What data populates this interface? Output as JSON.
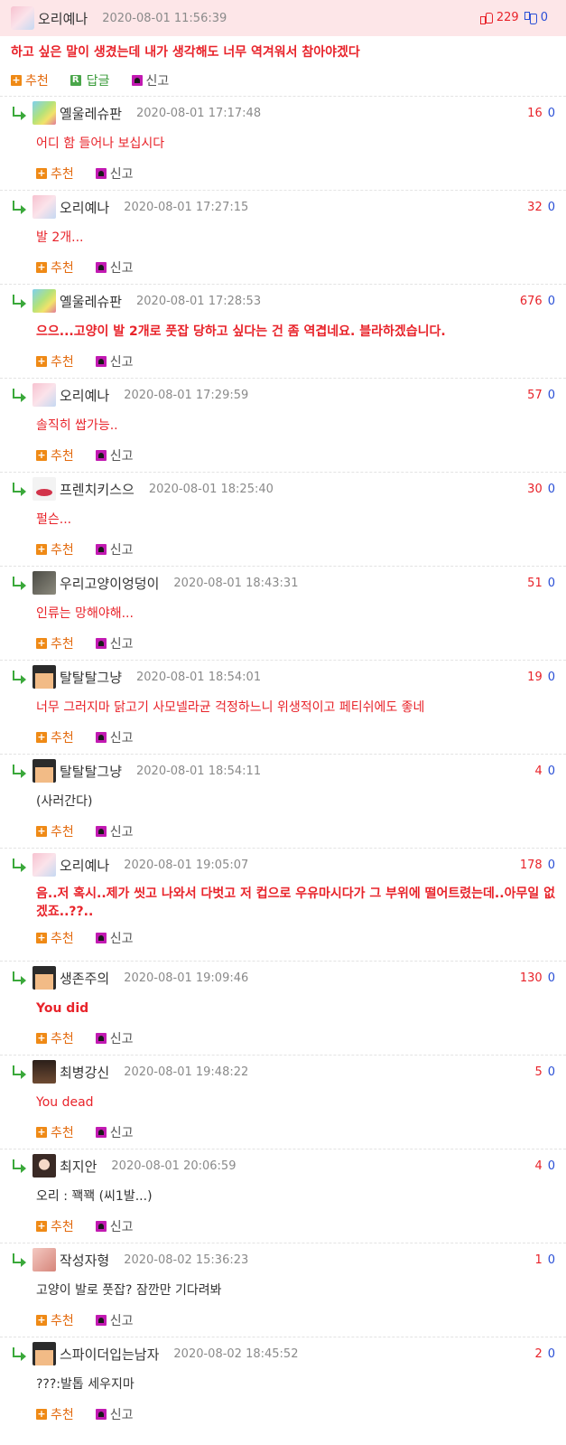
{
  "top": {
    "nick": "오리예나",
    "date": "2020-08-01 11:56:39",
    "up": "229",
    "down": "0",
    "body": "하고 싶은 말이 생겼는데 내가 생각해도 너무 역겨워서 참아야겠다",
    "recommend_label": "추천",
    "reply_label": "답글",
    "report_label": "신고"
  },
  "actions": {
    "recommend": "추천",
    "report": "신고"
  },
  "replies": [
    {
      "nick": "옐울레슈판",
      "date": "2020-08-01 17:17:48",
      "up": "16",
      "down": "0",
      "body": "어디 함 들어나 보십시다"
    },
    {
      "nick": "오리예나",
      "date": "2020-08-01 17:27:15",
      "up": "32",
      "down": "0",
      "body": "발 2개..."
    },
    {
      "nick": "옐울레슈판",
      "date": "2020-08-01 17:28:53",
      "up": "676",
      "down": "0",
      "body": "으으...고양이 발 2개로 풋잡 당하고 싶다는 건 좀 역겹네요. 블라하겠습니다."
    },
    {
      "nick": "오리예나",
      "date": "2020-08-01 17:29:59",
      "up": "57",
      "down": "0",
      "body": "솔직히 쌉가능.."
    },
    {
      "nick": "프렌치키스으",
      "date": "2020-08-01 18:25:40",
      "up": "30",
      "down": "0",
      "body": "펄슨..."
    },
    {
      "nick": "우리고양이엉덩이",
      "date": "2020-08-01 18:43:31",
      "up": "51",
      "down": "0",
      "body": "인류는 망해야해..."
    },
    {
      "nick": "탈탈탈그냥",
      "date": "2020-08-01 18:54:01",
      "up": "19",
      "down": "0",
      "body": "너무 그러지마 닭고기 사모넬라균 걱정하느니 위생적이고 페티쉬에도 좋네"
    },
    {
      "nick": "탈탈탈그냥",
      "date": "2020-08-01 18:54:11",
      "up": "4",
      "down": "0",
      "body": "(사러간다)"
    },
    {
      "nick": "오리예나",
      "date": "2020-08-01 19:05:07",
      "up": "178",
      "down": "0",
      "body": "음..저 혹시..제가 씻고 나와서 다벗고 저 컵으로 우유마시다가 그 부위에 떨어트렸는데..아무일 없겠죠..??.."
    },
    {
      "nick": "생존주의",
      "date": "2020-08-01 19:09:46",
      "up": "130",
      "down": "0",
      "body": "You did"
    },
    {
      "nick": "최병강신",
      "date": "2020-08-01 19:48:22",
      "up": "5",
      "down": "0",
      "body": "You dead"
    },
    {
      "nick": "최지안",
      "date": "2020-08-01 20:06:59",
      "up": "4",
      "down": "0",
      "body": "오리 : 꽥꽥 (씨1발...)"
    },
    {
      "nick": "작성자형",
      "date": "2020-08-02 15:36:23",
      "up": "1",
      "down": "0",
      "body": "고양이 발로 풋잡? 잠깐만 기다려봐"
    },
    {
      "nick": "스파이더입는남자",
      "date": "2020-08-02 18:45:52",
      "up": "2",
      "down": "0",
      "body": "???:발톱 세우지마"
    }
  ]
}
